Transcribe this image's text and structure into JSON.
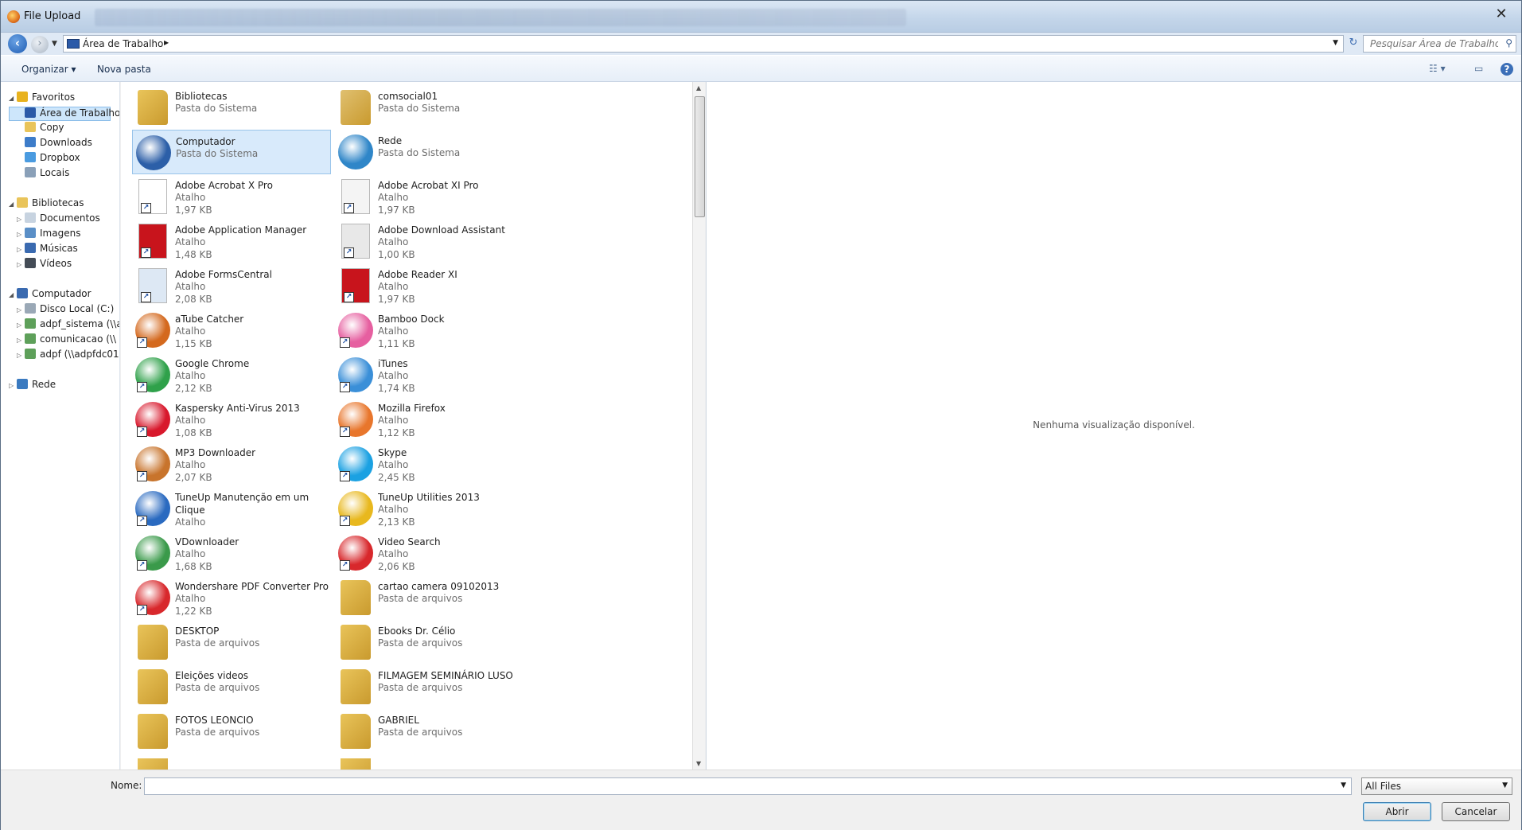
{
  "window": {
    "title": "File Upload",
    "close_glyph": "✕"
  },
  "address": {
    "path": "Área de Trabalho",
    "search_placeholder": "Pesquisar Área de Trabalho"
  },
  "toolbar": {
    "organize": "Organizar ▾",
    "new_folder": "Nova pasta"
  },
  "nav": [
    {
      "label": "Favoritos",
      "indent": 0,
      "twisty": "◢",
      "icon": "star-icon",
      "color": "#e8b21e"
    },
    {
      "label": "Área de Trabalho",
      "indent": 1,
      "twisty": "",
      "icon": "desktop-icon",
      "color": "#2b5aa8",
      "selected": true
    },
    {
      "label": "Copy",
      "indent": 1,
      "twisty": "",
      "icon": "folder-icon",
      "color": "#e9c45a"
    },
    {
      "label": "Downloads",
      "indent": 1,
      "twisty": "",
      "icon": "downloads-icon",
      "color": "#3d7cc9"
    },
    {
      "label": "Dropbox",
      "indent": 1,
      "twisty": "",
      "icon": "dropbox-icon",
      "color": "#4a9be0"
    },
    {
      "label": "Locais",
      "indent": 1,
      "twisty": "",
      "icon": "recent-places-icon",
      "color": "#8aa0b8"
    },
    {
      "label": "Bibliotecas",
      "indent": 0,
      "twisty": "◢",
      "icon": "libraries-icon",
      "color": "#e9c45a"
    },
    {
      "label": "Documentos",
      "indent": 1,
      "twisty": "▷",
      "icon": "documents-icon",
      "color": "#c7d3e0"
    },
    {
      "label": "Imagens",
      "indent": 1,
      "twisty": "▷",
      "icon": "images-icon",
      "color": "#5a8fc7"
    },
    {
      "label": "Músicas",
      "indent": 1,
      "twisty": "▷",
      "icon": "music-icon",
      "color": "#3a6ab0"
    },
    {
      "label": "Vídeos",
      "indent": 1,
      "twisty": "▷",
      "icon": "videos-icon",
      "color": "#444c56"
    },
    {
      "label": "Computador",
      "indent": 0,
      "twisty": "◢",
      "icon": "computer-icon",
      "color": "#3a6ab0"
    },
    {
      "label": "Disco Local (C:)",
      "indent": 1,
      "twisty": "▷",
      "icon": "drive-icon",
      "color": "#9aa8b6"
    },
    {
      "label": "adpf_sistema (\\\\a",
      "indent": 1,
      "twisty": "▷",
      "icon": "network-drive-icon",
      "color": "#5ea05a"
    },
    {
      "label": "comunicacao (\\\\",
      "indent": 1,
      "twisty": "▷",
      "icon": "network-drive-icon",
      "color": "#5ea05a"
    },
    {
      "label": "adpf (\\\\adpfdc01",
      "indent": 1,
      "twisty": "▷",
      "icon": "network-drive-icon",
      "color": "#5ea05a"
    },
    {
      "label": "Rede",
      "indent": 0,
      "twisty": "▷",
      "icon": "network-icon",
      "color": "#3a7ac0"
    }
  ],
  "files": [
    {
      "name": "Bibliotecas",
      "type": "Pasta do Sistema",
      "size": "",
      "icon": "libraries-icon",
      "color": "#e9c45a"
    },
    {
      "name": "comsocial01",
      "type": "Pasta do Sistema",
      "size": "",
      "icon": "user-folder-icon",
      "color": "#e0c070"
    },
    {
      "name": "Computador",
      "type": "Pasta do Sistema",
      "size": "",
      "icon": "computer-icon",
      "color": "#2c5fa8",
      "selected": true
    },
    {
      "name": "Rede",
      "type": "Pasta do Sistema",
      "size": "",
      "icon": "network-icon",
      "color": "#2f86c8"
    },
    {
      "name": "Adobe Acrobat X Pro",
      "type": "Atalho",
      "size": "1,97 KB",
      "icon": "blank-file-icon",
      "color": "#ffffff",
      "shortcut": true
    },
    {
      "name": "Adobe Acrobat XI Pro",
      "type": "Atalho",
      "size": "1,97 KB",
      "icon": "acrobat-icon",
      "color": "#f4f4f4",
      "shortcut": true
    },
    {
      "name": "Adobe Application Manager",
      "type": "Atalho",
      "size": "1,48 KB",
      "icon": "adobe-icon",
      "color": "#c8141c",
      "shortcut": true
    },
    {
      "name": "Adobe Download Assistant",
      "type": "Atalho",
      "size": "1,00 KB",
      "icon": "adobe-icon",
      "color": "#e8e8e8",
      "shortcut": true
    },
    {
      "name": "Adobe FormsCentral",
      "type": "Atalho",
      "size": "2,08 KB",
      "icon": "forms-icon",
      "color": "#dde8f4",
      "shortcut": true
    },
    {
      "name": "Adobe Reader XI",
      "type": "Atalho",
      "size": "1,97 KB",
      "icon": "reader-icon",
      "color": "#c8141c",
      "shortcut": true
    },
    {
      "name": "aTube Catcher",
      "type": "Atalho",
      "size": "1,15 KB",
      "icon": "atube-icon",
      "color": "#d4691e",
      "shortcut": true
    },
    {
      "name": "Bamboo Dock",
      "type": "Atalho",
      "size": "1,11 KB",
      "icon": "bamboo-icon",
      "color": "#e65fa0",
      "shortcut": true
    },
    {
      "name": "Google Chrome",
      "type": "Atalho",
      "size": "2,12 KB",
      "icon": "chrome-icon",
      "color": "#2fa14a",
      "shortcut": true
    },
    {
      "name": "iTunes",
      "type": "Atalho",
      "size": "1,74 KB",
      "icon": "itunes-icon",
      "color": "#3a8fd8",
      "shortcut": true
    },
    {
      "name": "Kaspersky Anti-Virus 2013",
      "type": "Atalho",
      "size": "1,08 KB",
      "icon": "kaspersky-icon",
      "color": "#d8182c",
      "shortcut": true
    },
    {
      "name": "Mozilla Firefox",
      "type": "Atalho",
      "size": "1,12 KB",
      "icon": "firefox-icon",
      "color": "#e8762c",
      "shortcut": true
    },
    {
      "name": "MP3 Downloader",
      "type": "Atalho",
      "size": "2,07 KB",
      "icon": "mp3-downloader-icon",
      "color": "#c8742c",
      "shortcut": true
    },
    {
      "name": "Skype",
      "type": "Atalho",
      "size": "2,45 KB",
      "icon": "skype-icon",
      "color": "#1ba1e2",
      "shortcut": true
    },
    {
      "name": "TuneUp Manutenção em um Clique",
      "type": "Atalho",
      "size": "",
      "icon": "tuneup-icon",
      "color": "#2a6ac0",
      "shortcut": true,
      "wrap": true
    },
    {
      "name": "TuneUp Utilities 2013",
      "type": "Atalho",
      "size": "2,13 KB",
      "icon": "tuneup-utilities-icon",
      "color": "#e8b81e",
      "shortcut": true
    },
    {
      "name": "VDownloader",
      "type": "Atalho",
      "size": "1,68 KB",
      "icon": "vdownloader-icon",
      "color": "#3a9a4a",
      "shortcut": true
    },
    {
      "name": "Video Search",
      "type": "Atalho",
      "size": "2,06 KB",
      "icon": "video-search-icon",
      "color": "#d8282c",
      "shortcut": true
    },
    {
      "name": "Wondershare PDF Converter Pro",
      "type": "Atalho",
      "size": "1,22 KB",
      "icon": "pdf-converter-icon",
      "color": "#d8282c",
      "shortcut": true
    },
    {
      "name": "cartao camera 09102013",
      "type": "Pasta de arquivos",
      "size": "",
      "icon": "folder-icon",
      "color": "#e9c45a"
    },
    {
      "name": "DESKTOP",
      "type": "Pasta de arquivos",
      "size": "",
      "icon": "folder-icon",
      "color": "#e9c45a"
    },
    {
      "name": "Ebooks Dr. Célio",
      "type": "Pasta de arquivos",
      "size": "",
      "icon": "folder-icon",
      "color": "#e9c45a"
    },
    {
      "name": "Eleições videos",
      "type": "Pasta de arquivos",
      "size": "",
      "icon": "folder-icon",
      "color": "#e9c45a"
    },
    {
      "name": "FILMAGEM SEMINÁRIO LUSO",
      "type": "Pasta de arquivos",
      "size": "",
      "icon": "folder-icon",
      "color": "#e9c45a"
    },
    {
      "name": "FOTOS LEONCIO",
      "type": "Pasta de arquivos",
      "size": "",
      "icon": "folder-icon",
      "color": "#e9c45a"
    },
    {
      "name": "GABRIEL",
      "type": "Pasta de arquivos",
      "size": "",
      "icon": "folder-icon",
      "color": "#e9c45a"
    }
  ],
  "preview": {
    "message": "Nenhuma visualização disponível."
  },
  "footer": {
    "name_label": "Nome:",
    "name_value": "",
    "filter": "All Files",
    "open": "Abrir",
    "cancel": "Cancelar"
  }
}
